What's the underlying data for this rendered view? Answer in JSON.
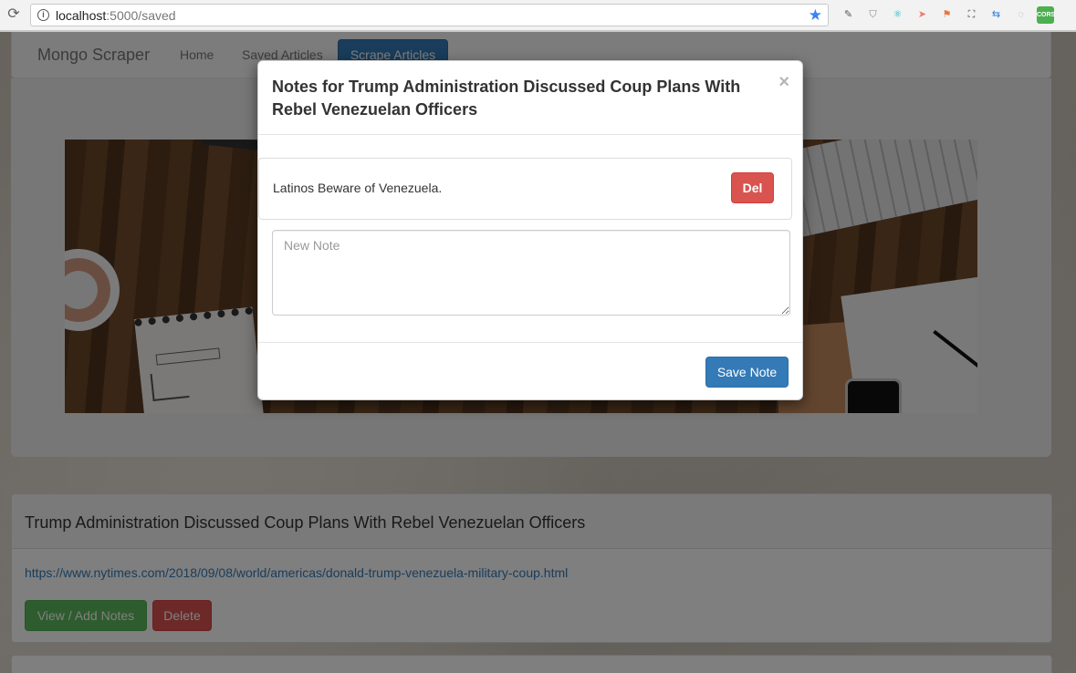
{
  "browser": {
    "url_host": "localhost",
    "url_path": ":5000/saved",
    "reload_icon": "reload-icon",
    "star_icon": "star-icon",
    "extensions": [
      "extension-icon",
      "shield-icon",
      "react-icon",
      "arrow-icon",
      "flag-icon",
      "screenshot-icon",
      "transfer-icon",
      "circle-icon",
      "cors-icon"
    ],
    "cors_label": "CORS"
  },
  "navbar": {
    "brand": "Mongo Scraper",
    "links": [
      "Home",
      "Saved Articles"
    ],
    "scrape_button": "Scrape Articles"
  },
  "article": {
    "title": "Trump Administration Discussed Coup Plans With Rebel Venezuelan Officers",
    "link": "https://www.nytimes.com/2018/09/08/world/americas/donald-trump-venezuela-military-coup.html",
    "notes_button": "View / Add Notes",
    "delete_button": "Delete"
  },
  "modal": {
    "title": "Notes for Trump Administration Discussed Coup Plans With Rebel Venezuelan Officers",
    "close": "×",
    "notes": [
      {
        "text": "Latinos Beware of Venezuela.",
        "delete_label": "Del"
      }
    ],
    "new_note_placeholder": "New Note",
    "new_note_value": "",
    "save_button": "Save Note"
  },
  "colors": {
    "primary": "#337ab7",
    "danger": "#d9534f",
    "success": "#5cb85c"
  }
}
